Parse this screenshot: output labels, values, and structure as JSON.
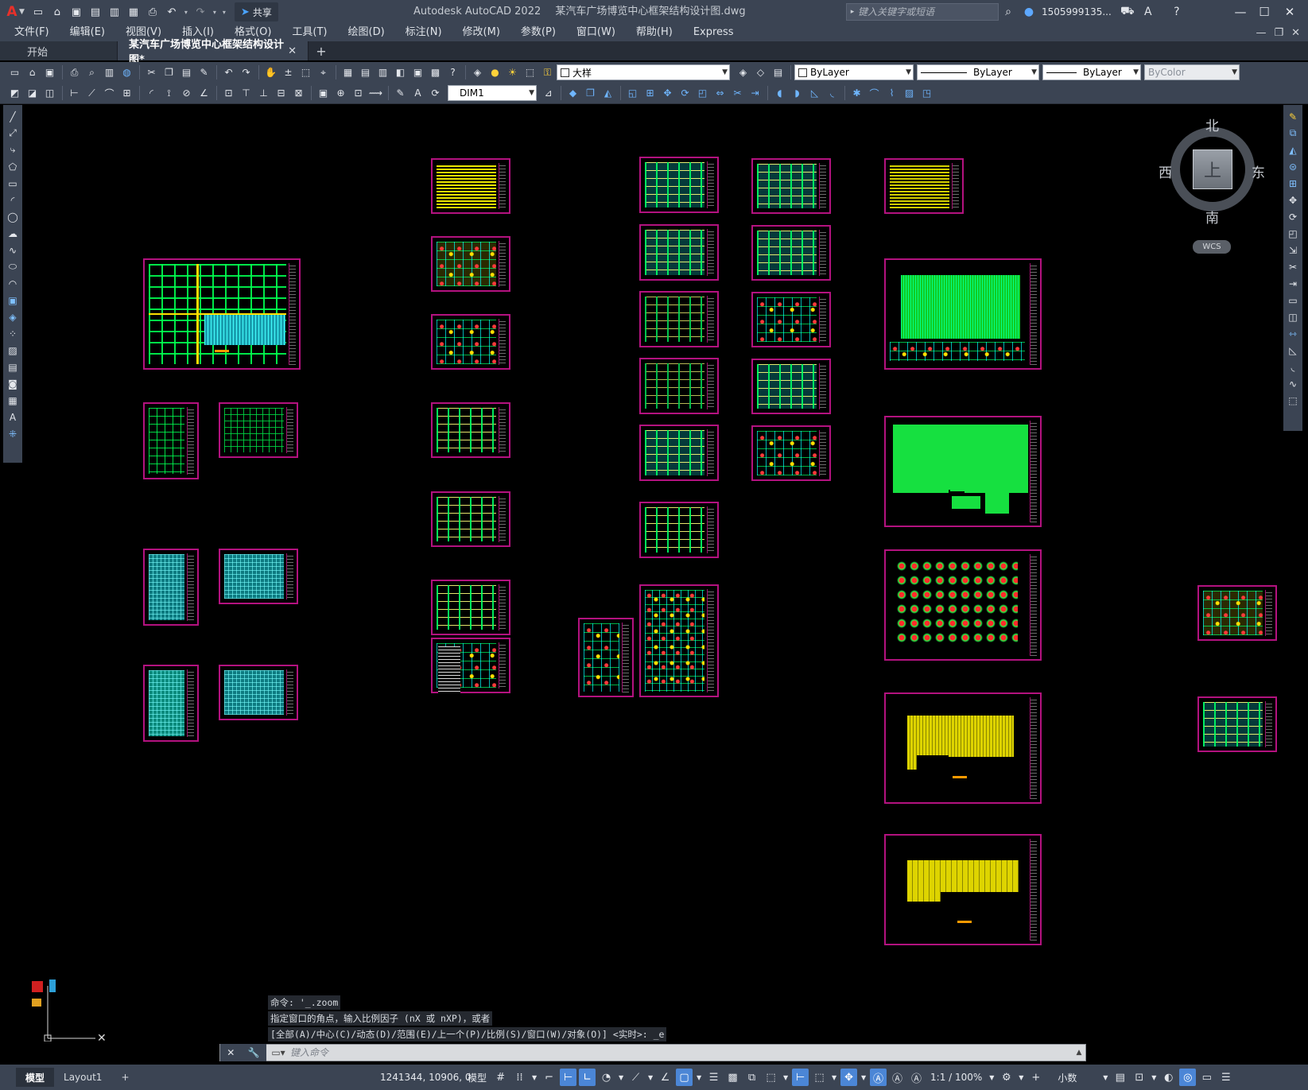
{
  "titlebar": {
    "app_name": "Autodesk AutoCAD 2022",
    "file_name": "某汽车广场博览中心框架结构设计图.dwg",
    "share_label": "共享",
    "search_placeholder": "键入关键字或短语",
    "user_name": "1505999135..."
  },
  "menu": [
    "文件(F)",
    "编辑(E)",
    "视图(V)",
    "插入(I)",
    "格式(O)",
    "工具(T)",
    "绘图(D)",
    "标注(N)",
    "修改(M)",
    "参数(P)",
    "窗口(W)",
    "帮助(H)",
    "Express"
  ],
  "tabs": {
    "start": "开始",
    "active": "某汽车广场博览中心框架结构设计图*",
    "add": "+"
  },
  "properties": {
    "layer": "大样",
    "color": "ByLayer",
    "linetype": "ByLayer",
    "lineweight": "ByLayer",
    "plotstyle": "ByColor",
    "dimstyle": "DIM1"
  },
  "viewcube": {
    "north": "北",
    "south": "南",
    "east": "东",
    "west": "西",
    "face": "上",
    "wcs": "WCS"
  },
  "command": {
    "history": [
      "命令: '_.zoom",
      "指定窗口的角点，输入比例因子 (nX 或 nXP)，或者",
      "[全部(A)/中心(C)/动态(D)/范围(E)/上一个(P)/比例(S)/窗口(W)/对象(O)] <实时>: _e"
    ],
    "placeholder": "键入命令"
  },
  "status": {
    "model_tab": "模型",
    "layout_tab": "Layout1",
    "add_tab": "+",
    "coordinates": "1241344, 10906, 0",
    "space": "模型",
    "scale": "1:1 / 100%",
    "units": "小数"
  },
  "colors": {
    "chrome": "#3b4453",
    "sheet_border": "#b3127f",
    "accent_blue": "#4b86d6"
  }
}
